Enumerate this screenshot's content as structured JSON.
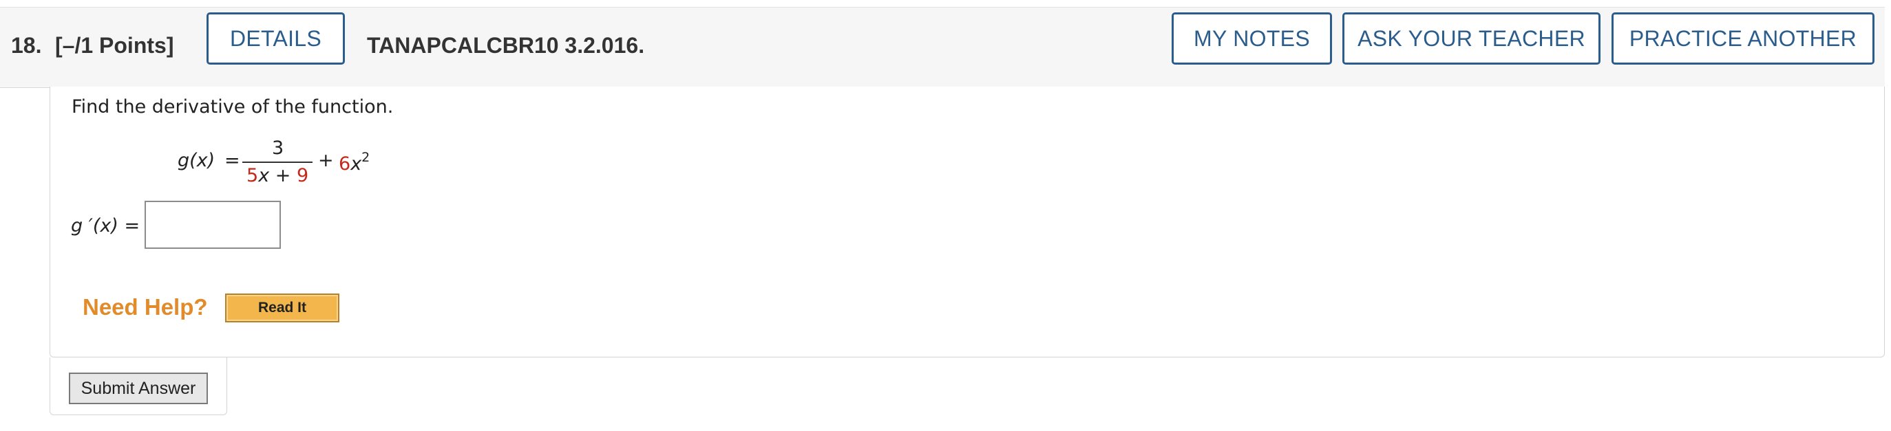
{
  "header": {
    "question_number": "18.",
    "points": "[–/1 Points]",
    "details_label": "DETAILS",
    "problem_code": "TANAPCALCBR10 3.2.016.",
    "my_notes_label": "MY NOTES",
    "ask_teacher_label": "ASK YOUR TEACHER",
    "practice_another_label": "PRACTICE ANOTHER"
  },
  "question": {
    "prompt": "Find the derivative of the function.",
    "function_name": "g(x)",
    "equals": "=",
    "numerator": "3",
    "denominator_coeff": "5",
    "denominator_var": "x + ",
    "denominator_const": "9",
    "plus": "+",
    "term_coeff": "6",
    "term_var": "x",
    "term_exp": "2",
    "answer_label": "g ′(x) =",
    "answer_value": ""
  },
  "help": {
    "need_help_label": "Need Help?",
    "read_it_label": "Read It"
  },
  "submit": {
    "label": "Submit Answer"
  },
  "colors": {
    "accent_blue": "#2b5d8c",
    "highlight_red": "#c6281b",
    "help_orange": "#e28b2a",
    "read_it_fill": "#f3b64c"
  }
}
